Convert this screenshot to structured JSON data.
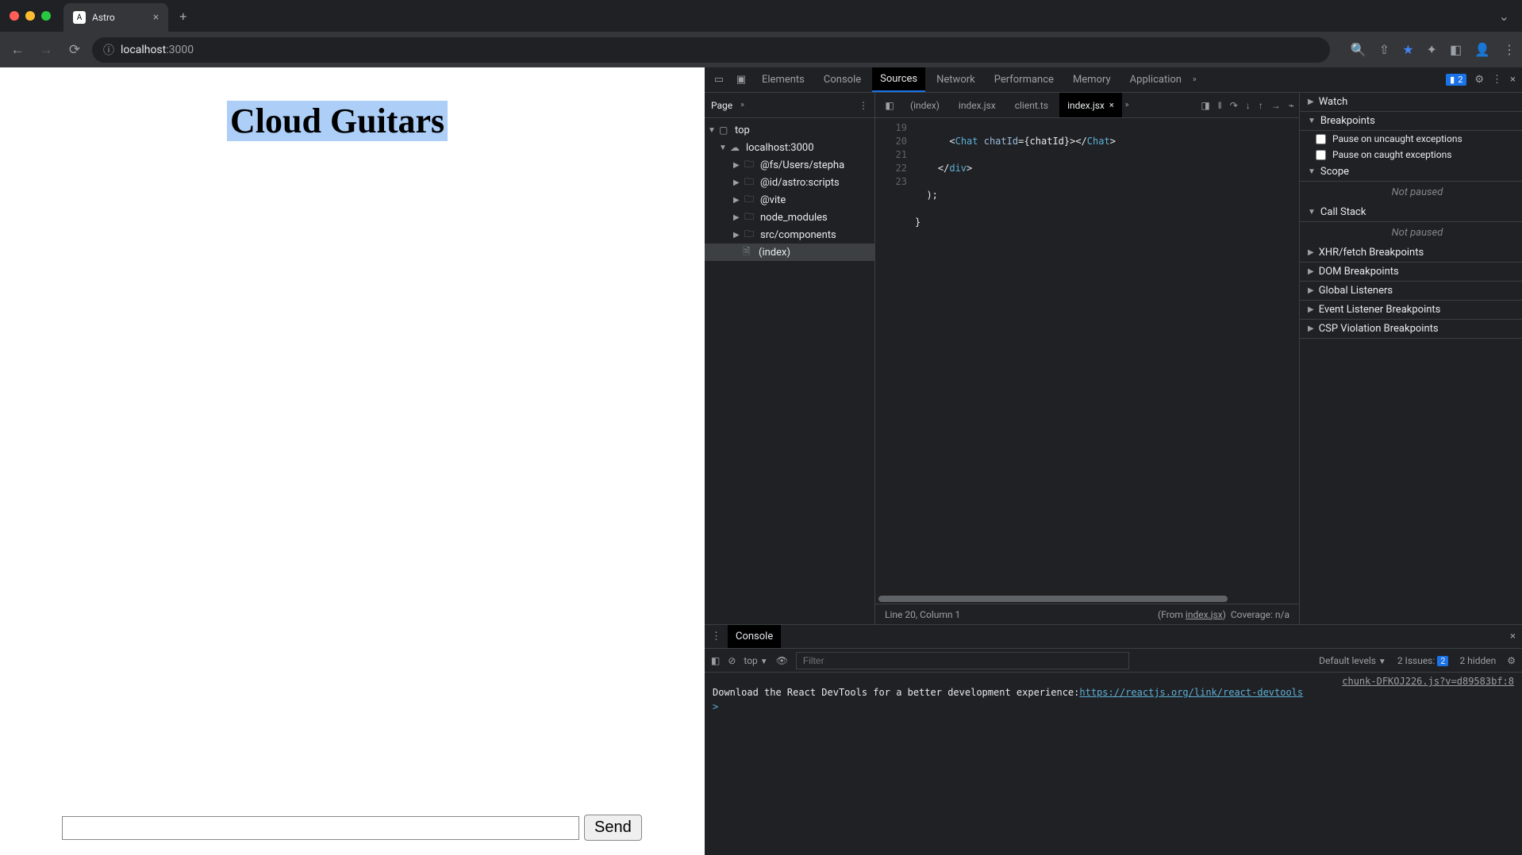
{
  "browser": {
    "tab_title": "Astro",
    "tab_favicon_text": "A",
    "address_host": "localhost",
    "address_port": ":3000"
  },
  "page": {
    "heading": "Cloud Guitars",
    "send_button": "Send"
  },
  "devtools": {
    "tabs": [
      "Elements",
      "Console",
      "Sources",
      "Network",
      "Performance",
      "Memory",
      "Application"
    ],
    "active_tab": "Sources",
    "issues_count": "2",
    "sources": {
      "nav_tab": "Page",
      "tree": {
        "root": "top",
        "host": "localhost:3000",
        "folders": [
          "@fs/Users/stepha",
          "@id/astro:scripts",
          "@vite",
          "node_modules",
          "src/components"
        ],
        "index_file": "(index)"
      },
      "open_files": [
        "(index)",
        "index.jsx",
        "client.ts",
        "index.jsx"
      ],
      "active_file": "index.jsx",
      "gutter_lines": [
        "19",
        "20",
        "21",
        "22",
        "23"
      ],
      "code": {
        "line19_a": "<",
        "line19_tag": "Chat",
        "line19_sp": " ",
        "line19_attr": "chatId",
        "line19_b": "={chatId}></",
        "line19_tag2": "Chat",
        "line19_c": ">",
        "line20": "    </div>",
        "line21": "  );",
        "line22": "}"
      },
      "status_line": "Line 20, Column 1",
      "status_from": "(From ",
      "status_file": "index.jsx",
      "status_close": ")",
      "coverage": "Coverage: n/a"
    },
    "debug": {
      "watch": "Watch",
      "breakpoints": "Breakpoints",
      "bp_uncaught": "Pause on uncaught exceptions",
      "bp_caught": "Pause on caught exceptions",
      "scope": "Scope",
      "scope_status": "Not paused",
      "callstack": "Call Stack",
      "callstack_status": "Not paused",
      "xhr": "XHR/fetch Breakpoints",
      "dom": "DOM Breakpoints",
      "listeners": "Global Listeners",
      "event": "Event Listener Breakpoints",
      "csp": "CSP Violation Breakpoints"
    },
    "console": {
      "tab": "Console",
      "context": "top",
      "filter_placeholder": "Filter",
      "levels": "Default levels",
      "issues_label": "2 Issues:",
      "issues_n": "2",
      "hidden": "2 hidden",
      "chunk_src": "chunk-DFKOJ226.js?v=d89583bf:8",
      "msg_prefix": "Download the React DevTools for a better development experience: ",
      "msg_link": "https://reactjs.org/link/react-devtools",
      "prompt": ">"
    }
  }
}
